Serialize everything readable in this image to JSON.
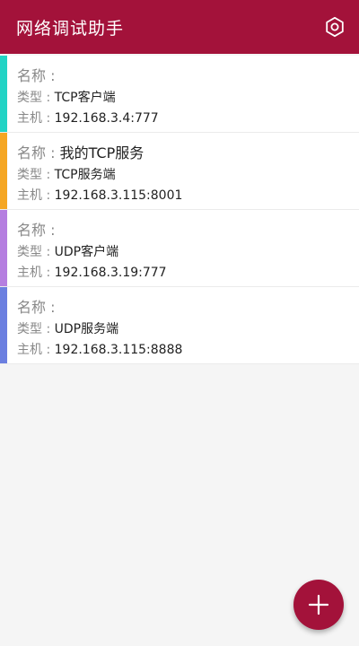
{
  "app": {
    "title": "网络调试助手"
  },
  "labels": {
    "name": "名称 : ",
    "type": "类型 : ",
    "host": "主机 : "
  },
  "connections": [
    {
      "name": "",
      "type": "TCP客户端",
      "host": "192.168.3.4:777",
      "accent": "#22d3c5"
    },
    {
      "name": "我的TCP服务",
      "type": "TCP服务端",
      "host": "192.168.3.115:8001",
      "accent": "#f5a623"
    },
    {
      "name": "",
      "type": "UDP客户端",
      "host": "192.168.3.19:777",
      "accent": "#b57ee0"
    },
    {
      "name": "",
      "type": "UDP服务端",
      "host": "192.168.3.115:8888",
      "accent": "#6b7fe0"
    }
  ],
  "colors": {
    "primary": "#a3123a",
    "background": "#f5f5f5"
  },
  "icons": {
    "settings": "hexagon-gear-icon",
    "add": "plus-icon"
  }
}
